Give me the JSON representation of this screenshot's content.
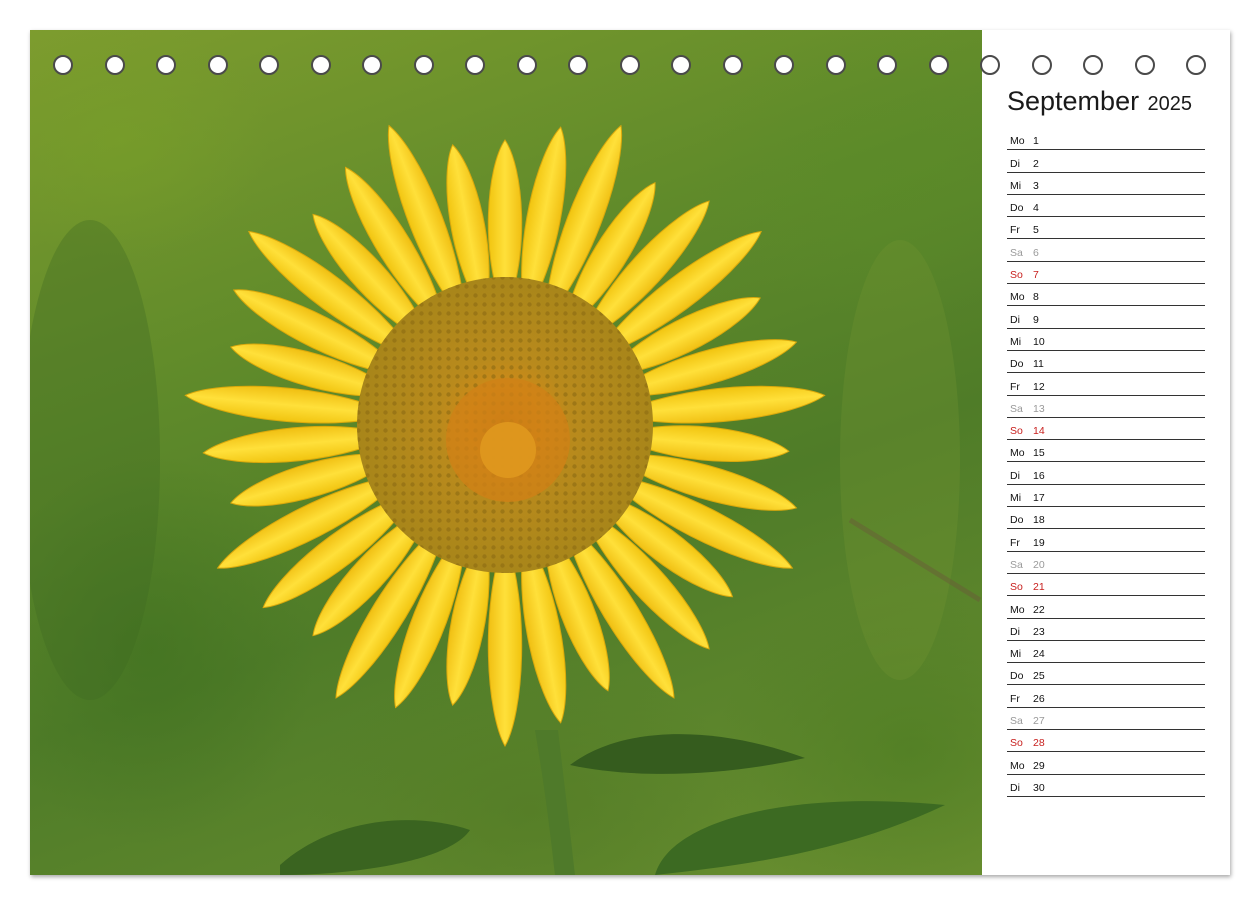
{
  "calendar": {
    "month": "September",
    "year": "2025",
    "days": [
      {
        "wd": "Mo",
        "d": "1",
        "type": "weekday"
      },
      {
        "wd": "Di",
        "d": "2",
        "type": "weekday"
      },
      {
        "wd": "Mi",
        "d": "3",
        "type": "weekday"
      },
      {
        "wd": "Do",
        "d": "4",
        "type": "weekday"
      },
      {
        "wd": "Fr",
        "d": "5",
        "type": "weekday"
      },
      {
        "wd": "Sa",
        "d": "6",
        "type": "saturday"
      },
      {
        "wd": "So",
        "d": "7",
        "type": "sunday"
      },
      {
        "wd": "Mo",
        "d": "8",
        "type": "weekday"
      },
      {
        "wd": "Di",
        "d": "9",
        "type": "weekday"
      },
      {
        "wd": "Mi",
        "d": "10",
        "type": "weekday"
      },
      {
        "wd": "Do",
        "d": "11",
        "type": "weekday"
      },
      {
        "wd": "Fr",
        "d": "12",
        "type": "weekday"
      },
      {
        "wd": "Sa",
        "d": "13",
        "type": "saturday"
      },
      {
        "wd": "So",
        "d": "14",
        "type": "sunday"
      },
      {
        "wd": "Mo",
        "d": "15",
        "type": "weekday"
      },
      {
        "wd": "Di",
        "d": "16",
        "type": "weekday"
      },
      {
        "wd": "Mi",
        "d": "17",
        "type": "weekday"
      },
      {
        "wd": "Do",
        "d": "18",
        "type": "weekday"
      },
      {
        "wd": "Fr",
        "d": "19",
        "type": "weekday"
      },
      {
        "wd": "Sa",
        "d": "20",
        "type": "saturday"
      },
      {
        "wd": "So",
        "d": "21",
        "type": "sunday"
      },
      {
        "wd": "Mo",
        "d": "22",
        "type": "weekday"
      },
      {
        "wd": "Di",
        "d": "23",
        "type": "weekday"
      },
      {
        "wd": "Mi",
        "d": "24",
        "type": "weekday"
      },
      {
        "wd": "Do",
        "d": "25",
        "type": "weekday"
      },
      {
        "wd": "Fr",
        "d": "26",
        "type": "weekday"
      },
      {
        "wd": "Sa",
        "d": "27",
        "type": "saturday"
      },
      {
        "wd": "So",
        "d": "28",
        "type": "sunday"
      },
      {
        "wd": "Mo",
        "d": "29",
        "type": "weekday"
      },
      {
        "wd": "Di",
        "d": "30",
        "type": "weekday"
      }
    ]
  },
  "colors": {
    "sunday": "#c8201e",
    "saturday": "#9a9a9a",
    "petal": "#f5d21c",
    "disc": "#b8860b"
  },
  "binding_holes": 23,
  "photo_subject_icon": "sunflower-icon"
}
